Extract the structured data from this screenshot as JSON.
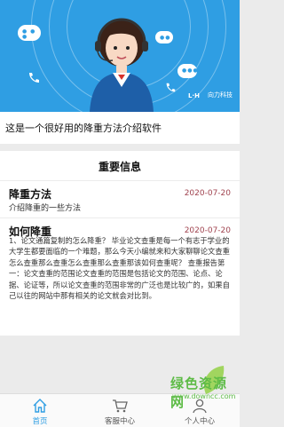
{
  "banner": {
    "brand_text": "向力科技",
    "brand_mark": "L·H"
  },
  "intro": {
    "text": "这是一个很好用的降重方法介绍软件"
  },
  "section": {
    "title": "重要信息"
  },
  "articles": [
    {
      "title": "降重方法",
      "date": "2020-07-20",
      "summary": "介绍降重的一些方法"
    },
    {
      "title": "如何降重",
      "date": "2020-07-20",
      "body": "1、论文通篇复制的怎么降重？ 毕业论文查重是每一个有志于学业的大学生都要面临的一个难题，那么今天小编就来和大家聊聊论文查重怎么查重那么查重怎么查重那么查重那该如何查重呢？ 查重报告第一：论文查重的范围论文查重的范围是包括论文的范围、论点、论据、论证等，所以论文查重的范围非常的广泛也是比较广的，如果自己以往的网站中那有相关的论文就会对比到。"
    }
  ],
  "tabs": [
    {
      "label": "首页",
      "icon": "home-icon",
      "active": true
    },
    {
      "label": "客服中心",
      "icon": "cart-icon",
      "active": false
    },
    {
      "label": "个人中心",
      "icon": "user-icon",
      "active": false
    }
  ],
  "watermark": {
    "text": "绿色资源网",
    "url": "www.downcc.com"
  },
  "colors": {
    "accent": "#2f9ee3",
    "date": "#a0434f",
    "watermark": "#5dbb46"
  }
}
